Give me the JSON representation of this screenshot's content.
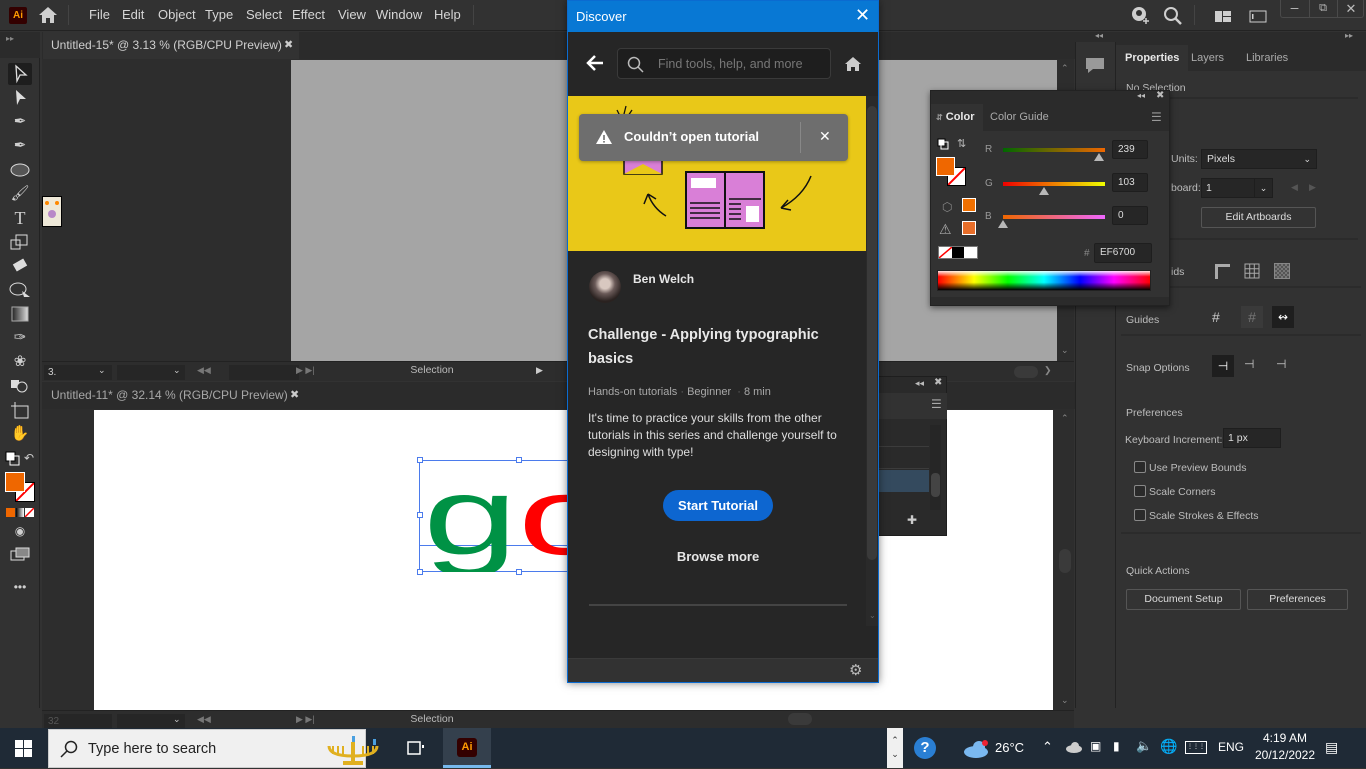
{
  "app": {
    "logo": "Ai",
    "menu": [
      "File",
      "Edit",
      "Object",
      "Type",
      "Select",
      "Effect",
      "View",
      "Window",
      "Help"
    ]
  },
  "documents": [
    {
      "title": "Untitled-15* @ 3.13 % (RGB/CPU Preview)",
      "zoom_field": "3.",
      "status": "Selection"
    },
    {
      "title": "Untitled-11* @ 32.14 % (RGB/CPU Preview)",
      "zoom_field": "32",
      "status": "Selection"
    }
  ],
  "artwork": {
    "letters": "go",
    "colors": [
      "#009245",
      "#ff0000"
    ]
  },
  "discover": {
    "title": "Discover",
    "search_placeholder": "Find tools, help, and more",
    "toast": "Couldn’t open tutorial",
    "author": "Ben Welch",
    "heading": "Challenge - Applying typographic basics",
    "meta": [
      "Hands-on tutorials",
      "Beginner",
      "8 min"
    ],
    "description": "It's time to practice your skills from the other tutorials in this series and challenge yourself to designing with type!",
    "start_btn": "Start Tutorial",
    "browse_btn": "Browse more",
    "accent": "#0d66d0"
  },
  "color_panel": {
    "tabs": [
      "Color",
      "Color Guide"
    ],
    "r": "239",
    "g": "103",
    "b": "0",
    "r_fraction": 0.937,
    "g_fraction": 0.404,
    "b_fraction": 0.0,
    "hex_label": "#",
    "hex": "EF6700",
    "fill_color": "#EF6700"
  },
  "properties": {
    "tabs": [
      "Properties",
      "Layers",
      "Libraries"
    ],
    "no_selection": "No Selection",
    "units_label": "Units:",
    "units_value": "Pixels",
    "artboard_label": "board:",
    "artboard_value": "1",
    "edit_artboards": "Edit Artboards",
    "rulers_label": "ids",
    "guides_label": "Guides",
    "snap_label": "Snap Options",
    "prefs_header": "Preferences",
    "kb_label": "Keyboard Increment:",
    "kb_value": "1 px",
    "checks": [
      "Use Preview Bounds",
      "Scale Corners",
      "Scale Strokes & Effects"
    ],
    "quick_actions": "Quick Actions",
    "doc_setup": "Document Setup",
    "preferences_btn": "Preferences"
  },
  "taskbar": {
    "search_placeholder": "Type here to search",
    "temperature": "26°C",
    "language": "ENG",
    "time": "4:19 AM",
    "date": "20/12/2022"
  }
}
